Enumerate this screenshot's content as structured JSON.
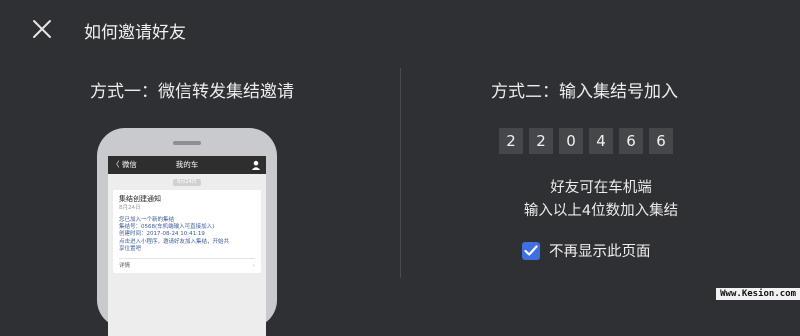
{
  "header": {
    "title": "如何邀请好友"
  },
  "method1": {
    "title": "方式一：微信转发集结邀请"
  },
  "method2": {
    "title": "方式二：输入集结号加入",
    "code": [
      "2",
      "2",
      "0",
      "4",
      "6",
      "6"
    ],
    "hint_line1": "好友可在车机端",
    "hint_line2": "输入以上4位数加入集结",
    "checkbox_label": "不再显示此页面",
    "checkbox_checked": true
  },
  "phone": {
    "back_label": "〈 微信",
    "chat_title": "我的车",
    "time_label": "8月24日",
    "card": {
      "title": "集结创建通知",
      "date": "8月24日",
      "lines": [
        "您已加入一个新的集结",
        "集结号：0568(车机端输入可直接加入)",
        "创建时间：2017-08-24 10:41:19",
        "点击进入小程序，邀请好友加入集结，开始共",
        "享位置吧"
      ],
      "detail_label": "详情"
    }
  },
  "watermark": "Www.Kesion.com",
  "colors": {
    "background": "#2f3033",
    "accent": "#3f6fe0",
    "code_box": "#46474b"
  }
}
